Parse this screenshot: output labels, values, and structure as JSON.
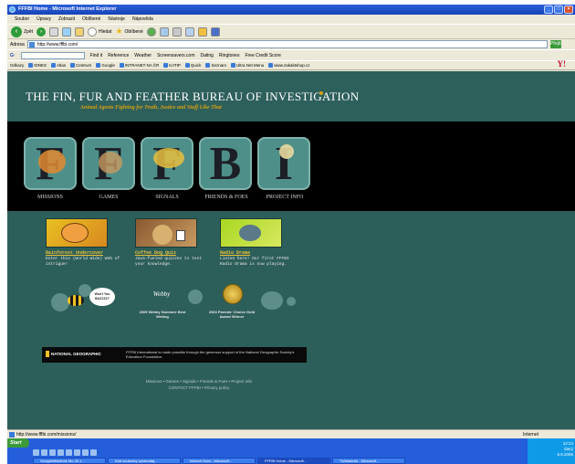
{
  "window": {
    "title": "FFFBI Home - Microsoft Internet Explorer"
  },
  "menu": [
    "Soubor",
    "Úpravy",
    "Zobrazit",
    "Oblíbené",
    "Nástroje",
    "Nápověda"
  ],
  "toolbar": {
    "back": "Zpět",
    "search": "Hledat",
    "favorites": "Oblíbené"
  },
  "address": {
    "label": "Adresa",
    "url": "http://www.fffbi.com/",
    "go": "Přejít"
  },
  "googlebar": {
    "find": "Find it",
    "reference": "Reference",
    "weather": "Weather",
    "screensavers": "Screensavers.com",
    "dating": "Dating",
    "ringtones": "Ringtones",
    "credit": "Free Credit Score"
  },
  "links": [
    "Odkazy",
    "IDNES",
    "Atlas",
    "Centrum",
    "Google",
    "INTRANET NA ČR",
    "KATIP",
    "Quick",
    "Seznam",
    "Ultra Net Menu",
    "www.zakaktshop.cz"
  ],
  "site": {
    "title": "The Fin, Fur and Feather Bureau of Investigation",
    "subtitle": "Animal Agents Fighting for Truth, Justice and Stuff Like That",
    "nav": [
      {
        "letter": "F",
        "label": "MISSIONS"
      },
      {
        "letter": "F",
        "label": "GAMES"
      },
      {
        "letter": "F",
        "label": "SIGNALS"
      },
      {
        "letter": "B",
        "label": "FRIENDS & FOES"
      },
      {
        "letter": "I",
        "label": "PROJECT INFO"
      }
    ],
    "promos": [
      {
        "title": "Rainforest Undercover",
        "text": "Enter this (World Wide) Web of intrigue!"
      },
      {
        "title": "Coffee Dog Quiz",
        "text": "Java-fueled quizzes to test your knowledge."
      },
      {
        "title": "Radio Drama",
        "text": "Listen here! Our first FFFBI Radio Drama is now playing."
      }
    ],
    "awards": [
      {
        "badge": "Won't You BUZZZZ?"
      },
      {
        "logo": "Webby",
        "caption": "2005 Webby Nominee Best Writing"
      },
      {
        "caption": "2004 Parents' Choice Gold Award Winner"
      }
    ],
    "natgeo": {
      "logo": "NATIONAL GEOGRAPHIC",
      "text": "FFFBI International is made possible through the generous support of the National Geographic Society's Education Foundation."
    },
    "footer": {
      "line1": "Missions • Games • Signals • Friends & Foes • Project Info",
      "line2": "CONTACT FFFBI • Privacy policy"
    }
  },
  "status": {
    "url": "http://www.fffbi.com/missions/",
    "zone": "Internet"
  },
  "taskbar": {
    "start": "Start",
    "tasks": [
      "Googlebibliothek Mo 20.1...",
      "Kód souborky zpravodaj...",
      "Internet Kam - Microsoft...",
      "FFFBI Home - Microsoft...",
      "Tvůrkabuta - Microsoft..."
    ],
    "clock": [
      "12:24",
      "úterý",
      "6.6.2006"
    ]
  }
}
